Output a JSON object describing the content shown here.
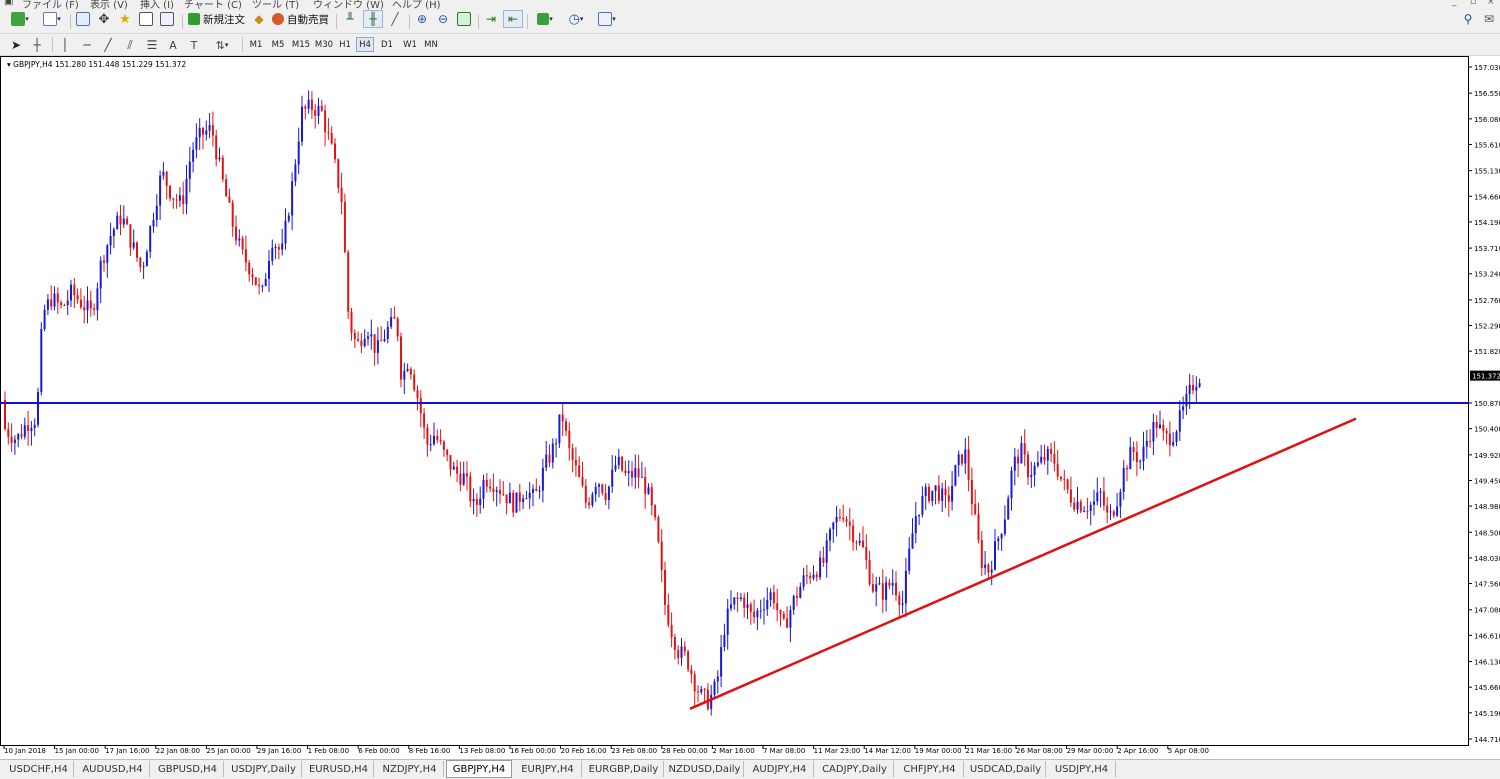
{
  "menu": {
    "items": [
      "ファイル (F)",
      "表示 (V)",
      "挿入 (I)",
      "チャート (C)",
      "ツール (T)",
      "ウィンドウ (W)",
      "ヘルプ (H)"
    ]
  },
  "toolbar": {
    "new_order_label": "新規注文",
    "auto_trading_label": "自動売買",
    "timeframes": [
      "M1",
      "M5",
      "M15",
      "M30",
      "H1",
      "H4",
      "D1",
      "W1",
      "MN"
    ],
    "active_timeframe": "H4"
  },
  "chart": {
    "header": "GBPJPY,H4  151.280 151.448 151.229 151.372",
    "current_price_label": "151.372",
    "colors": {
      "bull": "#1a1ad6",
      "bear": "#e01414",
      "hline": "#1010cc",
      "trendline": "#e01010",
      "price_tag": "#000000"
    }
  },
  "chart_data": {
    "type": "candlestick",
    "symbol": "GBPJPY",
    "timeframe": "H4",
    "ohlc": {
      "open": 151.28,
      "high": 151.448,
      "low": 151.229,
      "close": 151.372
    },
    "price_axis_labels": [
      "157.030",
      "156.550",
      "156.080",
      "155.610",
      "155.130",
      "154.660",
      "154.190",
      "153.710",
      "153.240",
      "152.760",
      "152.290",
      "151.820",
      "151.372",
      "150.870",
      "150.400",
      "149.920",
      "149.450",
      "148.980",
      "148.500",
      "148.030",
      "147.560",
      "147.080",
      "146.610",
      "146.130",
      "145.660",
      "145.190",
      "144.710"
    ],
    "price_axis_values": [
      157.03,
      156.55,
      156.08,
      155.61,
      155.13,
      154.66,
      154.19,
      153.71,
      153.24,
      152.76,
      152.29,
      151.82,
      151.372,
      150.87,
      150.4,
      149.92,
      149.45,
      148.98,
      148.5,
      148.03,
      147.56,
      147.08,
      146.61,
      146.13,
      145.66,
      145.19,
      144.71
    ],
    "time_axis_labels": [
      "10 Jan 2018",
      "15 Jan 00:00",
      "17 Jan 16:00",
      "22 Jan 08:00",
      "25 Jan 00:00",
      "29 Jan 16:00",
      "1 Feb 08:00",
      "6 Feb 00:00",
      "8 Feb 16:00",
      "13 Feb 08:00",
      "16 Feb 00:00",
      "20 Feb 16:00",
      "23 Feb 08:00",
      "28 Feb 00:00",
      "2 Mar 16:00",
      "7 Mar 08:00",
      "11 Mar 23:00",
      "14 Mar 12:00",
      "19 Mar 00:00",
      "21 Mar 16:00",
      "26 Mar 08:00",
      "29 Mar 00:00",
      "2 Apr 16:00",
      "5 Apr 08:00"
    ],
    "price_path": [
      [
        0,
        151.8
      ],
      [
        8,
        150.4
      ],
      [
        20,
        150.2
      ],
      [
        30,
        150.5
      ],
      [
        40,
        150.6
      ],
      [
        46,
        152.5
      ],
      [
        55,
        152.8
      ],
      [
        65,
        152.6
      ],
      [
        75,
        152.9
      ],
      [
        85,
        152.7
      ],
      [
        95,
        152.5
      ],
      [
        105,
        153.5
      ],
      [
        115,
        154.0
      ],
      [
        125,
        154.3
      ],
      [
        135,
        153.8
      ],
      [
        145,
        153.3
      ],
      [
        155,
        154.2
      ],
      [
        165,
        155.1
      ],
      [
        175,
        154.7
      ],
      [
        185,
        154.5
      ],
      [
        195,
        155.5
      ],
      [
        205,
        155.8
      ],
      [
        215,
        155.9
      ],
      [
        225,
        155.0
      ],
      [
        235,
        154.2
      ],
      [
        245,
        153.6
      ],
      [
        255,
        153.3
      ],
      [
        265,
        152.8
      ],
      [
        275,
        153.9
      ],
      [
        285,
        153.6
      ],
      [
        295,
        154.8
      ],
      [
        305,
        156.2
      ],
      [
        315,
        156.3
      ],
      [
        325,
        156.2
      ],
      [
        335,
        155.5
      ],
      [
        345,
        154.6
      ],
      [
        352,
        152.4
      ],
      [
        360,
        151.9
      ],
      [
        370,
        152.3
      ],
      [
        380,
        151.8
      ],
      [
        390,
        152.2
      ],
      [
        400,
        152.4
      ],
      [
        405,
        151.3
      ],
      [
        412,
        151.7
      ],
      [
        418,
        151.2
      ],
      [
        422,
        150.9
      ],
      [
        430,
        150.1
      ],
      [
        438,
        150.3
      ],
      [
        448,
        149.9
      ],
      [
        458,
        149.6
      ],
      [
        468,
        149.5
      ],
      [
        478,
        148.9
      ],
      [
        488,
        149.5
      ],
      [
        498,
        149.4
      ],
      [
        508,
        149.2
      ],
      [
        518,
        149.0
      ],
      [
        528,
        149.3
      ],
      [
        538,
        149.1
      ],
      [
        548,
        149.7
      ],
      [
        558,
        150.1
      ],
      [
        565,
        150.7
      ],
      [
        572,
        150.0
      ],
      [
        580,
        149.6
      ],
      [
        590,
        149.0
      ],
      [
        600,
        149.5
      ],
      [
        610,
        149.2
      ],
      [
        620,
        149.8
      ],
      [
        630,
        149.5
      ],
      [
        640,
        149.6
      ],
      [
        650,
        149.3
      ],
      [
        660,
        148.5
      ],
      [
        668,
        147.2
      ],
      [
        675,
        146.7
      ],
      [
        682,
        146.3
      ],
      [
        690,
        146.2
      ],
      [
        697,
        145.8
      ],
      [
        704,
        145.5
      ],
      [
        712,
        145.4
      ],
      [
        720,
        145.7
      ],
      [
        728,
        146.8
      ],
      [
        736,
        147.2
      ],
      [
        746,
        147.3
      ],
      [
        756,
        146.9
      ],
      [
        766,
        147.2
      ],
      [
        776,
        147.4
      ],
      [
        786,
        146.7
      ],
      [
        796,
        147.2
      ],
      [
        806,
        147.6
      ],
      [
        816,
        147.8
      ],
      [
        826,
        147.9
      ],
      [
        836,
        148.6
      ],
      [
        846,
        148.9
      ],
      [
        856,
        148.5
      ],
      [
        866,
        148.2
      ],
      [
        876,
        147.5
      ],
      [
        886,
        147.4
      ],
      [
        896,
        147.6
      ],
      [
        906,
        147.2
      ],
      [
        914,
        148.3
      ],
      [
        920,
        148.9
      ],
      [
        930,
        149.2
      ],
      [
        940,
        149.3
      ],
      [
        950,
        149.0
      ],
      [
        960,
        149.7
      ],
      [
        968,
        150.0
      ],
      [
        976,
        149.0
      ],
      [
        984,
        148.0
      ],
      [
        992,
        147.8
      ],
      [
        1000,
        148.3
      ],
      [
        1008,
        148.8
      ],
      [
        1016,
        149.7
      ],
      [
        1024,
        150.0
      ],
      [
        1032,
        149.6
      ],
      [
        1040,
        149.7
      ],
      [
        1050,
        149.9
      ],
      [
        1058,
        149.8
      ],
      [
        1066,
        149.4
      ],
      [
        1076,
        149.1
      ],
      [
        1086,
        149.0
      ],
      [
        1096,
        149.0
      ],
      [
        1104,
        149.2
      ],
      [
        1112,
        148.7
      ],
      [
        1120,
        149.1
      ],
      [
        1128,
        149.7
      ],
      [
        1136,
        150.0
      ],
      [
        1144,
        149.8
      ],
      [
        1152,
        150.3
      ],
      [
        1160,
        150.5
      ],
      [
        1168,
        150.2
      ],
      [
        1176,
        150.3
      ],
      [
        1184,
        150.6
      ],
      [
        1190,
        150.9
      ],
      [
        1196,
        151.2
      ],
      [
        1202,
        151.37
      ]
    ],
    "support_line_level": 150.87,
    "trendline": {
      "start": {
        "time": "28 Feb",
        "price": 145.19
      },
      "end": {
        "time": "after 5 Apr 08:00",
        "price": 150.4
      }
    },
    "current_price": 151.372,
    "grid": false
  },
  "tabs": [
    "USDCHF,H4",
    "AUDUSD,H4",
    "GBPUSD,H4",
    "USDJPY,Daily",
    "EURUSD,H4",
    "NZDJPY,H4",
    "GBPJPY,H4",
    "EURJPY,H4",
    "EURGBP,Daily",
    "NZDUSD,Daily",
    "AUDJPY,H4",
    "CADJPY,Daily",
    "CHFJPY,H4",
    "USDCAD,Daily",
    "USDJPY,H4"
  ],
  "active_tab": "GBPJPY,H4"
}
